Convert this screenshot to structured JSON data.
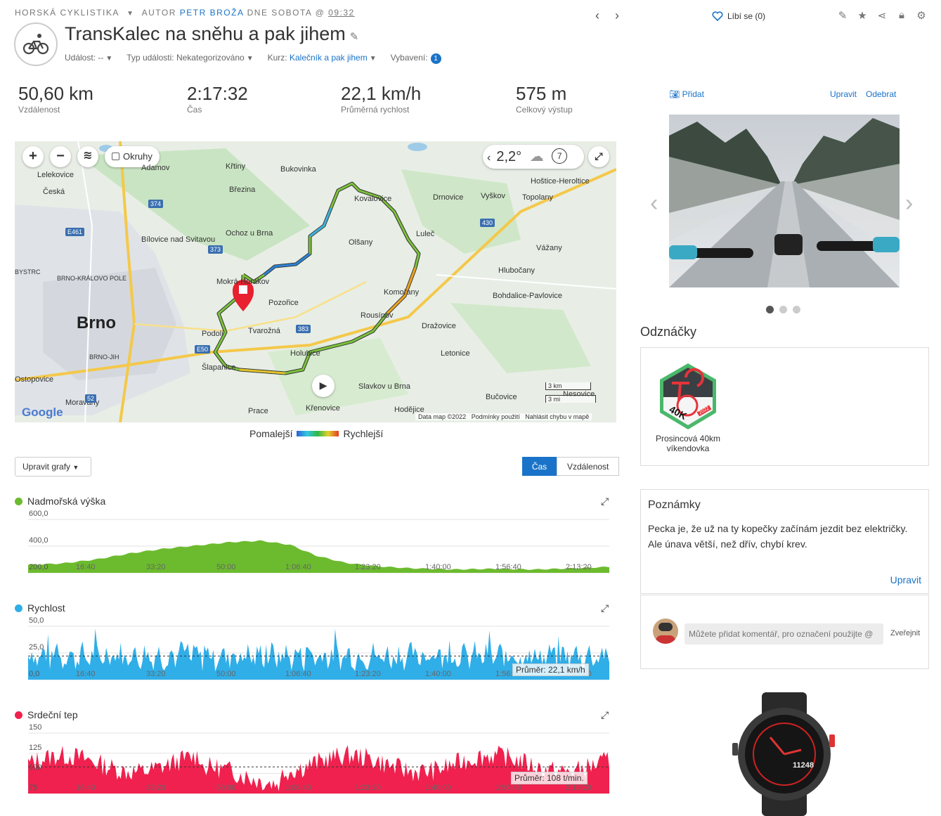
{
  "header": {
    "category": "HORSKÁ CYKLISTIKA",
    "author_prefix": "AUTOR",
    "author": "PETR BROŽA",
    "date_text": "DNE SOBOTA @",
    "time": "09:32",
    "like_label": "Líbí se (0)"
  },
  "activity": {
    "title": "TransKalec na sněhu a pak jihem",
    "event_label": "Událost: --",
    "event_type_label": "Typ události: Nekategorizováno",
    "course_prefix": "Kurz:",
    "course_value": "Kalečník a pak jihem",
    "gear_label": "Vybavení:",
    "gear_count": "1"
  },
  "stats": [
    {
      "value": "50,60 km",
      "label": "Vzdálenost"
    },
    {
      "value": "2:17:32",
      "label": "Čas"
    },
    {
      "value": "22,1 km/h",
      "label": "Průměrná rychlost"
    },
    {
      "value": "575 m",
      "label": "Celkový výstup"
    }
  ],
  "map": {
    "laps_label": "Okruhy",
    "temperature": "2,2°",
    "wind": "7",
    "city_big": "Brno",
    "places": [
      "Lelekovice",
      "Adamov",
      "Křtiny",
      "Bukovinka",
      "Česká",
      "Březina",
      "Ochoz u Brna",
      "Bílovice nad Svitavou",
      "Mokrá-Horákov",
      "Pozořice",
      "Tvarožná",
      "Podolí",
      "Šlapanice",
      "Holubice",
      "Slavkov u Brna",
      "Křenovice",
      "Prace",
      "Moravany",
      "Ostopovice",
      "BRNO-JIH",
      "BRNO-KRÁLOVO POLE",
      "BYSTRC",
      "Olšany",
      "Luleč",
      "Vyškov",
      "Drnovice",
      "Hoštice-Heroltice",
      "Topolany",
      "Vážany",
      "Hlubočany",
      "Bohdalice-Pavlovice",
      "Kovalovice",
      "Rousínov",
      "Komořany",
      "Dražovice",
      "Letonice",
      "Bučovice",
      "Hodějice",
      "Nesovice"
    ],
    "scale_km": "3 km",
    "scale_mi": "3 mi",
    "attribution": "Data map ©2022",
    "terms": "Podmínky použití",
    "report": "Nahlásit chybu v mapě",
    "google": "Google",
    "legend_slow": "Pomalejší",
    "legend_fast": "Rychlejší"
  },
  "controls": {
    "edit_charts": "Upravit grafy",
    "toggle_time": "Čas",
    "toggle_distance": "Vzdálenost"
  },
  "chart_data": [
    {
      "type": "area",
      "title": "Nadmořská výška",
      "color": "#6cbb2e",
      "yticks": [
        "600,0",
        "400,0",
        "200,0"
      ],
      "ylim": [
        200,
        600
      ],
      "x": [
        "16:40",
        "33:20",
        "50:00",
        "1:06:40",
        "1:23:20",
        "1:40:00",
        "1:56:40",
        "2:13:20"
      ],
      "xlim_min": [
        0,
        137.5
      ],
      "values_by_min": [
        [
          0,
          260
        ],
        [
          8,
          270
        ],
        [
          16,
          300
        ],
        [
          24,
          345
        ],
        [
          32,
          380
        ],
        [
          40,
          405
        ],
        [
          48,
          430
        ],
        [
          55,
          440
        ],
        [
          62,
          410
        ],
        [
          68,
          330
        ],
        [
          75,
          275
        ],
        [
          82,
          250
        ],
        [
          90,
          235
        ],
        [
          100,
          225
        ],
        [
          110,
          230
        ],
        [
          120,
          225
        ],
        [
          130,
          235
        ],
        [
          137.5,
          245
        ]
      ]
    },
    {
      "type": "area",
      "title": "Rychlost",
      "color": "#30aee8",
      "yticks": [
        "50,0",
        "25,0",
        "0,0"
      ],
      "ylim": [
        0,
        50
      ],
      "x": [
        "16:40",
        "33:20",
        "50:00",
        "1:06:40",
        "1:23:20",
        "1:40:00",
        "1:56:40",
        "2:13:20"
      ],
      "average_label": "Průměr: 22,1 km/h",
      "average": 22.1
    },
    {
      "type": "area",
      "title": "Srdeční tep",
      "color": "#f0214e",
      "yticks": [
        "150",
        "125",
        "100",
        "75"
      ],
      "ylim": [
        75,
        150
      ],
      "x": [
        "16:40",
        "33:20",
        "50:00",
        "1:06:40",
        "1:23:20",
        "1:40:00",
        "1:56:40",
        "2:13:20"
      ],
      "average_label": "Průměr: 108 t/min.",
      "average": 108
    }
  ],
  "photos": {
    "add_label": "Přidat",
    "edit_label": "Upravit",
    "remove_label": "Odebrat"
  },
  "badges": {
    "title": "Odznáčky",
    "badge_name": "Prosincová 40km víkendovka",
    "badge_text": "40K",
    "badge_year": "2022"
  },
  "notes": {
    "title": "Poznámky",
    "text": "Pecka je, že už na ty kopečky začínám jezdit bez električky. Ale únava větší, než dřív, chybí krev.",
    "edit_label": "Upravit"
  },
  "comment": {
    "placeholder": "Můžete přidat komentář, pro označení použijte @",
    "publish_label": "Zveřejnit"
  },
  "watch": {
    "number": "11248"
  }
}
